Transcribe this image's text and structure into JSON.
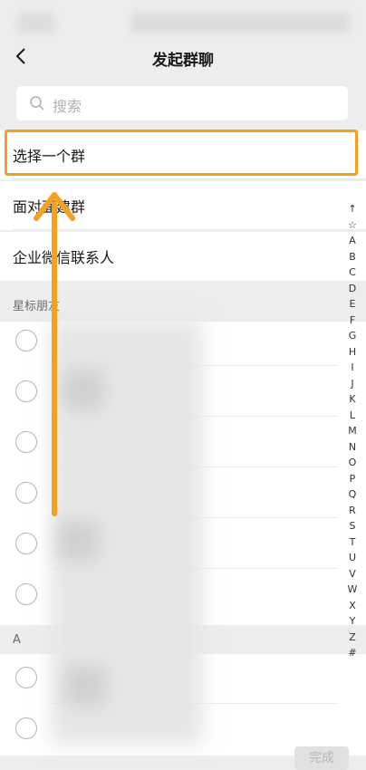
{
  "header": {
    "title": "发起群聊"
  },
  "search": {
    "placeholder": "搜索"
  },
  "rows": {
    "select_group": "选择一个群",
    "face_to_face": "面对面建群",
    "wecom": "企业微信联系人"
  },
  "sections": {
    "starred": "星标朋友",
    "a": "A"
  },
  "index": [
    "↑",
    "☆",
    "A",
    "B",
    "C",
    "D",
    "E",
    "F",
    "G",
    "H",
    "I",
    "J",
    "K",
    "L",
    "M",
    "N",
    "O",
    "P",
    "Q",
    "R",
    "S",
    "T",
    "U",
    "V",
    "W",
    "X",
    "Y",
    "Z",
    "#"
  ],
  "footer": {
    "done_label": "完成"
  },
  "colors": {
    "highlight": "#f5a021",
    "background": "#ededed"
  },
  "icons": [
    "back-arrow-icon",
    "search-icon",
    "up-arrow-annotation-icon"
  ]
}
